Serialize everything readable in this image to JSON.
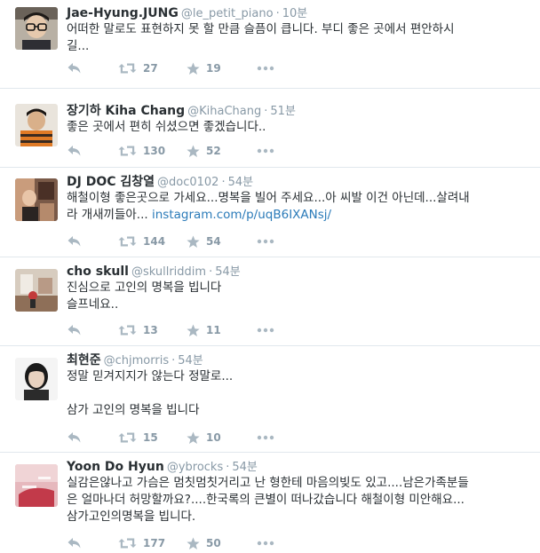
{
  "tweets": [
    {
      "name": "Jae-Hyung.JUNG",
      "handle": "@le_petit_piano",
      "time": "10분",
      "lines": [
        "어떠한 말로도 표현하지 못 할 만큼 슬픔이 큽니다. 부디 좋은 곳에서 편안하시",
        "길..."
      ],
      "retweets": "27",
      "favorites": "19"
    },
    {
      "name": "장기하 Kiha Chang",
      "handle": "@KihaChang",
      "time": "51분",
      "lines": [
        "좋은 곳에서 편히 쉬셨으면 좋겠습니다.."
      ],
      "retweets": "130",
      "favorites": "52"
    },
    {
      "name": "DJ DOC 김창열",
      "handle": "@doc0102",
      "time": "54분",
      "lines": [
        "해철이형 좋은곳으로 가세요...명복을 빌어 주세요...아 씨발 이건 아닌데...살려내",
        "라 개새끼들아..."
      ],
      "link": "instagram.com/p/uqB6IXANsj/",
      "retweets": "144",
      "favorites": "54"
    },
    {
      "name": "cho skull",
      "handle": "@skullriddim",
      "time": "54분",
      "lines": [
        "진심으로 고인의 명복을 빕니다",
        "슬프네요.."
      ],
      "retweets": "13",
      "favorites": "11"
    },
    {
      "name": "최현준",
      "handle": "@chjmorris",
      "time": "54분",
      "lines": [
        "정말 믿겨지지가 않는다 정말로...",
        "",
        "삼가 고인의 명복을 빕니다"
      ],
      "retweets": "15",
      "favorites": "10"
    },
    {
      "name": "Yoon Do Hyun",
      "handle": "@ybrocks",
      "time": "54분",
      "lines": [
        "실감은않나고 가슴은 멈칫멈칫거리고 난 형한테 마음의빚도 있고....남은가족분들",
        "은 얼마나더 허망할까요?....한국록의 큰별이 떠나갔습니다 해철이형 미안해요...",
        "삼가고인의명복을 빕니다."
      ],
      "retweets": "177",
      "favorites": "50"
    }
  ],
  "colors": {
    "text": "#292f33",
    "meta": "#8899a6",
    "icon": "#aab8c2",
    "link": "#2b7bb9",
    "divider": "#e1e8ed"
  },
  "icons": {
    "reply": "reply-icon",
    "retweet": "retweet-icon",
    "favorite": "star-icon",
    "more": "more-dots-icon"
  }
}
